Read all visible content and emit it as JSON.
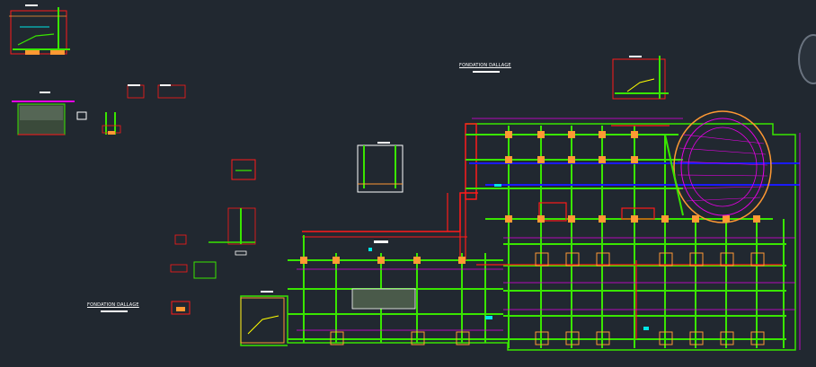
{
  "drawing": {
    "background": "#212830",
    "labels": {
      "top_title": "FONDATION DALLAGE",
      "bottom_title": "FONDATION DALLAGE"
    },
    "colors": {
      "beam_green": "#39e600",
      "wall_red": "#ff1a1a",
      "dim_magenta": "#e600e6",
      "axis_blue": "#1a1aff",
      "footing_orange": "#ff9933",
      "text_white": "#ffffff",
      "cyan": "#00e6e6",
      "yellow": "#ffff00"
    }
  }
}
